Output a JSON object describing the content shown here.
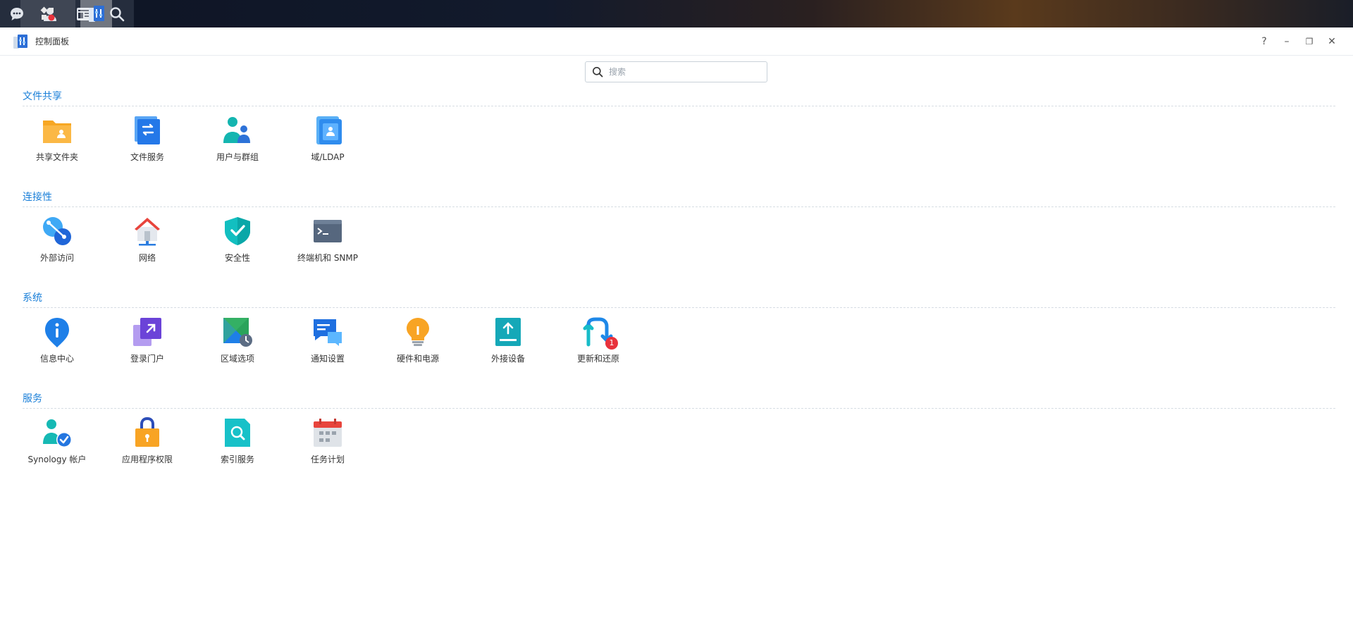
{
  "window": {
    "title": "控制面板",
    "help": "?",
    "minimize": "–",
    "restore": "❐",
    "close": "✕"
  },
  "search": {
    "placeholder": "搜索",
    "value": ""
  },
  "sections": [
    {
      "title": "文件共享",
      "items": [
        {
          "label": "共享文件夹",
          "icon": "shared-folder-icon"
        },
        {
          "label": "文件服务",
          "icon": "file-services-icon"
        },
        {
          "label": "用户与群组",
          "icon": "users-groups-icon"
        },
        {
          "label": "域/LDAP",
          "icon": "domain-ldap-icon"
        }
      ]
    },
    {
      "title": "连接性",
      "items": [
        {
          "label": "外部访问",
          "icon": "external-access-icon"
        },
        {
          "label": "网络",
          "icon": "network-icon"
        },
        {
          "label": "安全性",
          "icon": "security-icon"
        },
        {
          "label": "终端机和 SNMP",
          "icon": "terminal-snmp-icon"
        }
      ]
    },
    {
      "title": "系统",
      "items": [
        {
          "label": "信息中心",
          "icon": "info-center-icon"
        },
        {
          "label": "登录门户",
          "icon": "login-portal-icon"
        },
        {
          "label": "区域选项",
          "icon": "regional-options-icon"
        },
        {
          "label": "通知设置",
          "icon": "notification-icon"
        },
        {
          "label": "硬件和电源",
          "icon": "hardware-power-icon"
        },
        {
          "label": "外接设备",
          "icon": "external-devices-icon"
        },
        {
          "label": "更新和还原",
          "icon": "update-restore-icon",
          "badge": "1"
        }
      ]
    },
    {
      "title": "服务",
      "items": [
        {
          "label": "Synology 帐户",
          "icon": "synology-account-icon"
        },
        {
          "label": "应用程序权限",
          "icon": "app-privileges-icon"
        },
        {
          "label": "索引服务",
          "icon": "indexing-service-icon"
        },
        {
          "label": "任务计划",
          "icon": "task-scheduler-icon"
        }
      ]
    }
  ],
  "colors": {
    "accent": "#1a7fd8",
    "badge": "#e8323c"
  }
}
